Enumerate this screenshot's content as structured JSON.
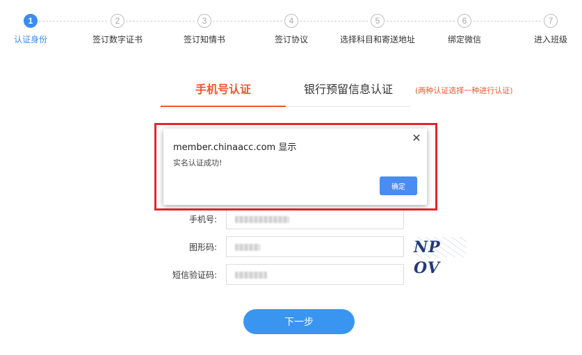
{
  "steps": [
    {
      "num": "1",
      "label": "认证身份"
    },
    {
      "num": "2",
      "label": "签订数字证书"
    },
    {
      "num": "3",
      "label": "签订知情书"
    },
    {
      "num": "4",
      "label": "签订协议"
    },
    {
      "num": "5",
      "label": "选择科目和寄送地址"
    },
    {
      "num": "6",
      "label": "绑定微信"
    },
    {
      "num": "7",
      "label": "进入班级"
    }
  ],
  "active_step": 1,
  "tabs": {
    "phone": "手机号认证",
    "bank": "银行预留信息认证",
    "note": "(两种认证选择一种进行认证)"
  },
  "form": {
    "phone_label": "手机号:",
    "captcha_label": "图形码:",
    "sms_label": "短信验证码:",
    "captcha_text": "NP OV",
    "next_button": "下一步"
  },
  "dialog": {
    "title": "member.chinaacc.com 显示",
    "message": "实名认证成功!",
    "ok_button": "确定",
    "close_glyph": "✕"
  },
  "colors": {
    "accent_blue": "#3b8bf1",
    "tab_active": "#f0562d",
    "highlight_red": "#e3262a",
    "button_blue": "#3a95f1"
  }
}
